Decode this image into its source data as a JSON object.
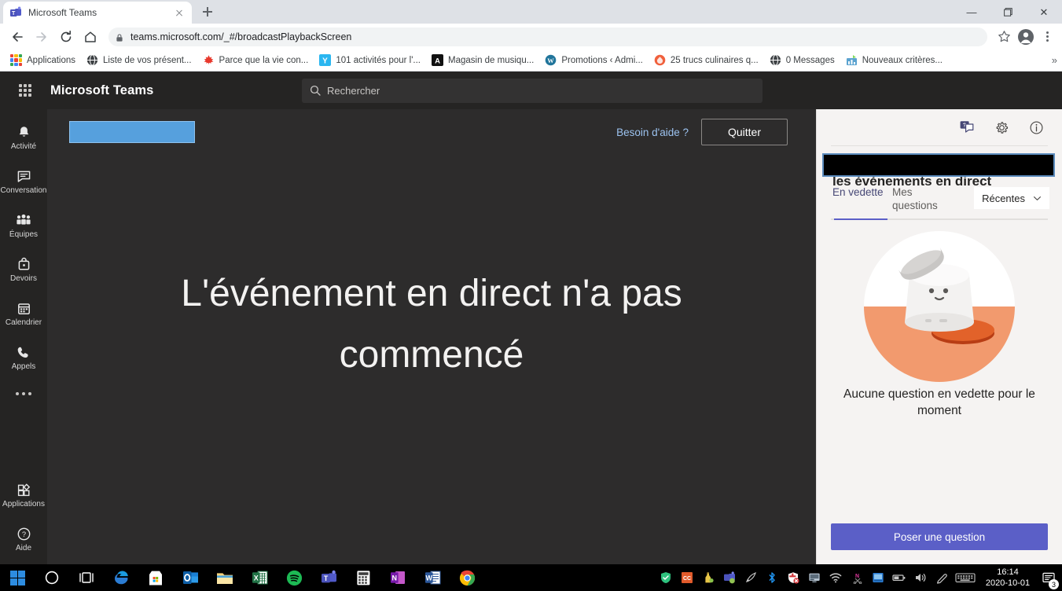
{
  "browser": {
    "tab": {
      "title": "Microsoft Teams",
      "favicon": "teams-icon",
      "close": "close-icon"
    },
    "newtab_tooltip": "+",
    "window_controls": {
      "minimize": "—",
      "maximize": "❐",
      "close": "✕"
    },
    "nav": {
      "back": "back-arrow-icon",
      "forward": "forward-arrow-icon",
      "reload": "reload-icon",
      "home": "home-icon"
    },
    "omnibox": {
      "url": "teams.microsoft.com/_#/broadcastPlaybackScreen",
      "lock": "lock-icon",
      "star": "star-icon"
    },
    "profile": "profile-avatar-icon",
    "menu": "three-dot-menu-icon",
    "bookmarks": [
      {
        "label": "Applications",
        "icon": "apps-grid-icon"
      },
      {
        "label": "Liste de vos présent...",
        "icon": "globe-icon"
      },
      {
        "label": "Parce que la vie con...",
        "icon": "maple-leaf-icon"
      },
      {
        "label": "101 activités pour l'...",
        "icon": "yahoo-icon"
      },
      {
        "label": "Magasin de musiqu...",
        "icon": "amazon-icon"
      },
      {
        "label": "Promotions ‹ Admi...",
        "icon": "wordpress-icon"
      },
      {
        "label": "25 trucs culinaires q...",
        "icon": "flame-icon"
      },
      {
        "label": "0 Messages",
        "icon": "globe-icon"
      },
      {
        "label": "Nouveaux critères...",
        "icon": "chart-icon"
      }
    ],
    "bookmarks_overflow": "»"
  },
  "teams": {
    "waffle": "app-launcher-icon",
    "brand": "Microsoft Teams",
    "search": {
      "placeholder": "Rechercher",
      "icon": "search-icon"
    },
    "redacted_account_field": "",
    "rail": [
      {
        "label": "Activité",
        "icon": "bell-icon"
      },
      {
        "label": "Conversation",
        "icon": "chat-icon"
      },
      {
        "label": "Équipes",
        "icon": "people-icon"
      },
      {
        "label": "Devoirs",
        "icon": "briefcase-icon"
      },
      {
        "label": "Calendrier",
        "icon": "calendar-icon"
      },
      {
        "label": "Appels",
        "icon": "phone-icon"
      }
    ],
    "rail_more": "more-dots-icon",
    "rail_bottom": [
      {
        "label": "Applications",
        "icon": "apps-icon"
      },
      {
        "label": "Aide",
        "icon": "help-circle-icon"
      }
    ]
  },
  "stage": {
    "redacted_title": "",
    "help_link": "Besoin d'aide ?",
    "quit_button": "Quitter",
    "message": "L'événement en direct n'a pas commencé"
  },
  "qa": {
    "header_icons": [
      {
        "name": "qna-app-icon"
      },
      {
        "name": "gear-icon"
      },
      {
        "name": "info-circle-icon"
      }
    ],
    "title": "Questions et réponses sur les événements en direct",
    "help_icon": "help-circle-icon",
    "close_icon": "close-icon",
    "tabs": [
      {
        "label": "En vedette",
        "active": true
      },
      {
        "label": "Mes questions",
        "active": false
      }
    ],
    "sort": {
      "label": "Récentes",
      "chevron": "chevron-down-icon"
    },
    "illustration": "empty-state-jar-illustration",
    "empty_text": "Aucune question en vedette pour le moment",
    "ask_button": "Poser une question"
  },
  "taskbar": {
    "apps": [
      {
        "name": "windows-start-icon"
      },
      {
        "name": "cortana-search-icon"
      },
      {
        "name": "task-view-icon"
      },
      {
        "name": "edge-icon"
      },
      {
        "name": "microsoft-store-icon"
      },
      {
        "name": "outlook-icon"
      },
      {
        "name": "file-explorer-icon"
      },
      {
        "name": "excel-icon"
      },
      {
        "name": "spotify-icon"
      },
      {
        "name": "teams-icon"
      },
      {
        "name": "calculator-icon"
      },
      {
        "name": "onenote-icon"
      },
      {
        "name": "word-icon"
      },
      {
        "name": "chrome-icon"
      }
    ],
    "tray": [
      {
        "name": "shield-icon"
      },
      {
        "name": "ccu-icon"
      },
      {
        "name": "bottle-icon"
      },
      {
        "name": "teams-tray-icon"
      },
      {
        "name": "satellite-icon"
      },
      {
        "name": "bluetooth-icon"
      },
      {
        "name": "security-warning-icon"
      },
      {
        "name": "display-icon"
      },
      {
        "name": "wifi-icon"
      },
      {
        "name": "snip-tool-icon"
      },
      {
        "name": "onedrive-icon"
      },
      {
        "name": "battery-icon"
      },
      {
        "name": "volume-icon"
      },
      {
        "name": "pen-icon"
      },
      {
        "name": "keyboard-icon"
      }
    ],
    "clock": {
      "time": "16:14",
      "date": "2020-10-01"
    },
    "notifications": {
      "icon": "action-center-icon",
      "count": "3"
    }
  },
  "colors": {
    "teams_purple": "#5b5fc7",
    "teams_header": "#252423",
    "stage_bg": "#2d2c2c",
    "panel_bg": "#f5f3f2",
    "redaction_blue": "#56a0dd",
    "link_blue": "#9cc3f0"
  }
}
